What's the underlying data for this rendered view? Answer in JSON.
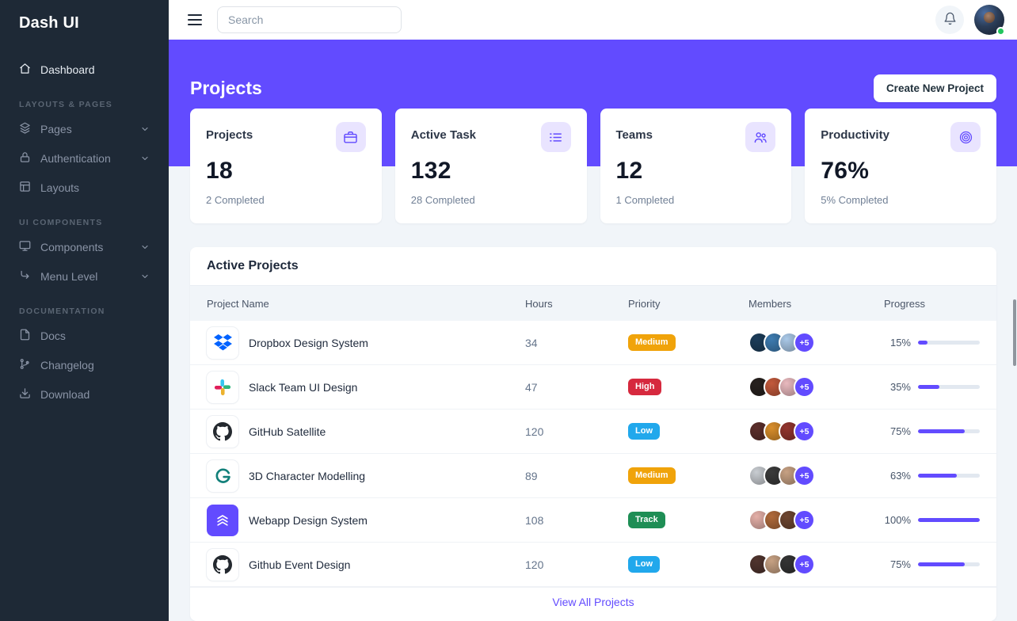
{
  "sidebar": {
    "brand": "Dash UI",
    "dashboard": "Dashboard",
    "section_layouts": "LAYOUTS & PAGES",
    "pages": "Pages",
    "authentication": "Authentication",
    "layouts": "Layouts",
    "section_ui": "UI COMPONENTS",
    "components": "Components",
    "menu_level": "Menu Level",
    "section_docs": "DOCUMENTATION",
    "docs": "Docs",
    "changelog": "Changelog",
    "download": "Download"
  },
  "topbar": {
    "search_placeholder": "Search"
  },
  "hero": {
    "title": "Projects",
    "create_button": "Create New Project"
  },
  "stats": [
    {
      "title": "Projects",
      "value": "18",
      "subtitle": "2 Completed",
      "icon": "briefcase-icon"
    },
    {
      "title": "Active Task",
      "value": "132",
      "subtitle": "28 Completed",
      "icon": "list-task-icon"
    },
    {
      "title": "Teams",
      "value": "12",
      "subtitle": "1 Completed",
      "icon": "people-icon"
    },
    {
      "title": "Productivity",
      "value": "76%",
      "subtitle": "5% Completed",
      "icon": "target-icon"
    }
  ],
  "table": {
    "title": "Active Projects",
    "columns": [
      "Project Name",
      "Hours",
      "Priority",
      "Members",
      "Progress"
    ],
    "rows": [
      {
        "name": "Dropbox Design System",
        "hours": "34",
        "priority": "Medium",
        "priority_color": "#F0A30A",
        "icon": "dropbox-icon",
        "avatars": [
          "#1C3D5A",
          "#3E7CB1",
          "#AAC9E8"
        ],
        "extra_members": "+5",
        "progress_label": "15%",
        "progress_pct": 15
      },
      {
        "name": "Slack Team UI Design",
        "hours": "47",
        "priority": "High",
        "priority_color": "#D6293E",
        "icon": "slack-icon",
        "avatars": [
          "#27211E",
          "#C2593B",
          "#E9B9BE"
        ],
        "extra_members": "+5",
        "progress_label": "35%",
        "progress_pct": 35
      },
      {
        "name": "GitHub Satellite",
        "hours": "120",
        "priority": "Low",
        "priority_color": "#21A8EC",
        "icon": "github-icon",
        "avatars": [
          "#5C2E2B",
          "#D98E2B",
          "#93352E"
        ],
        "extra_members": "+5",
        "progress_label": "75%",
        "progress_pct": 75
      },
      {
        "name": "3D Character Modelling",
        "hours": "89",
        "priority": "Medium",
        "priority_color": "#F0A30A",
        "icon": "threed-icon",
        "avatars": [
          "#C9CDD2",
          "#3B3B3B",
          "#C7A183"
        ],
        "extra_members": "+5",
        "progress_label": "63%",
        "progress_pct": 63
      },
      {
        "name": "Webapp Design System",
        "hours": "108",
        "priority": "Track",
        "priority_color": "#1E8E55",
        "icon": "webapp-icon",
        "avatars": [
          "#E5B0A8",
          "#B06A3B",
          "#6E4630"
        ],
        "extra_members": "+5",
        "progress_label": "100%",
        "progress_pct": 100
      },
      {
        "name": "Github Event Design",
        "hours": "120",
        "priority": "Low",
        "priority_color": "#21A8EC",
        "icon": "github-icon",
        "avatars": [
          "#50342E",
          "#C7A183",
          "#343434"
        ],
        "extra_members": "+5",
        "progress_label": "75%",
        "progress_pct": 75
      }
    ],
    "footer_link": "View All Projects"
  },
  "colors": {
    "primary": "#624BFF",
    "sidebar_bg": "#1E2936",
    "page_bg": "#F1F5F9",
    "online_dot": "#22C55E"
  }
}
